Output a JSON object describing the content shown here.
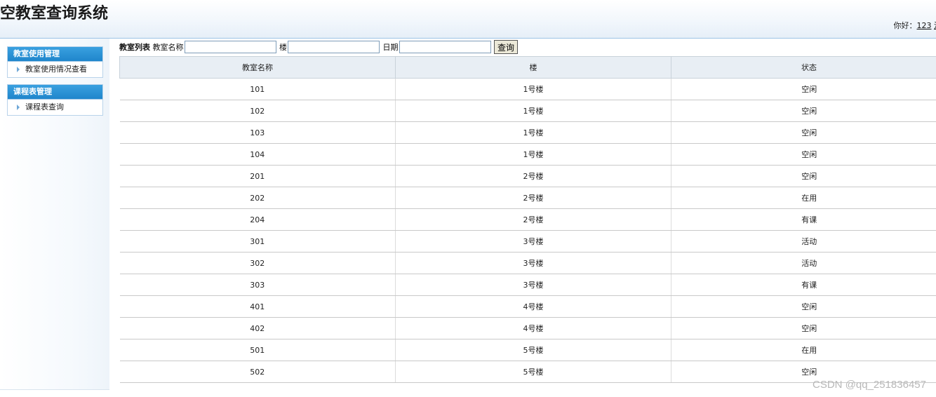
{
  "header": {
    "title": "空教室查询系统",
    "greeting": "你好：",
    "username": "123",
    "logout_link": "注"
  },
  "sidebar": {
    "groups": [
      {
        "title": "教室使用管理",
        "items": [
          {
            "label": "教室使用情况查看"
          }
        ]
      },
      {
        "title": "课程表管理",
        "items": [
          {
            "label": "课程表查询"
          }
        ]
      }
    ]
  },
  "toolbar": {
    "list_title": "教室列表",
    "name_label": "教室名称",
    "name_value": "",
    "building_label": "楼",
    "building_value": "",
    "date_label": "日期",
    "date_value": "",
    "search_button": "查询"
  },
  "table": {
    "headers": [
      "教室名称",
      "楼",
      "状态"
    ],
    "rows": [
      [
        "101",
        "1号楼",
        "空闲"
      ],
      [
        "102",
        "1号楼",
        "空闲"
      ],
      [
        "103",
        "1号楼",
        "空闲"
      ],
      [
        "104",
        "1号楼",
        "空闲"
      ],
      [
        "201",
        "2号楼",
        "空闲"
      ],
      [
        "202",
        "2号楼",
        "在用"
      ],
      [
        "204",
        "2号楼",
        "有课"
      ],
      [
        "301",
        "3号楼",
        "活动"
      ],
      [
        "302",
        "3号楼",
        "活动"
      ],
      [
        "303",
        "3号楼",
        "有课"
      ],
      [
        "401",
        "4号楼",
        "空闲"
      ],
      [
        "402",
        "4号楼",
        "空闲"
      ],
      [
        "501",
        "5号楼",
        "在用"
      ],
      [
        "502",
        "5号楼",
        "空闲"
      ]
    ]
  },
  "watermark": "CSDN @qq_251836457",
  "colors": {
    "menu_header": "#1f86cc",
    "table_header_bg": "#e8eef4",
    "header_border": "#9cc3e6"
  }
}
